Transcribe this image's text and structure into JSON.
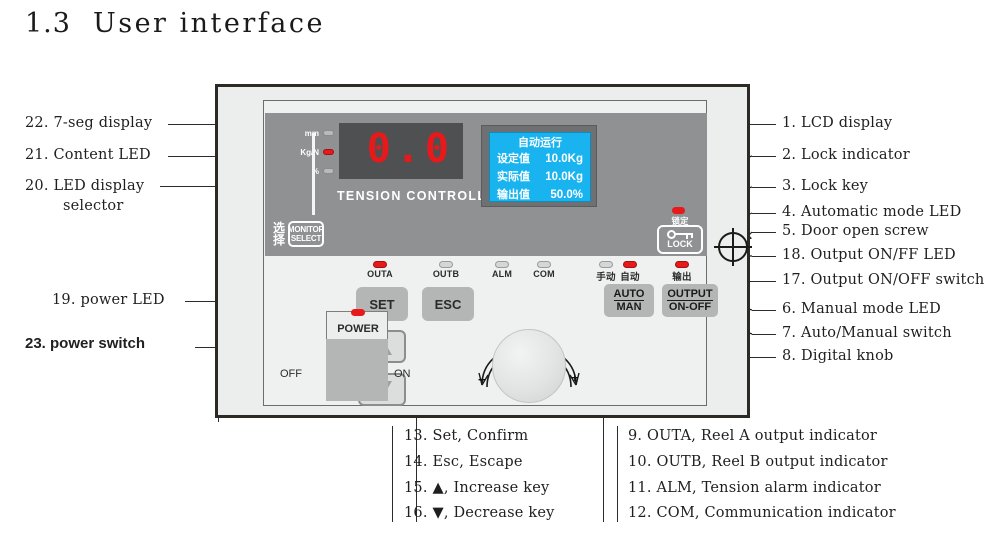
{
  "page": {
    "section_number": "1.3",
    "section_title": "User interface"
  },
  "callouts_left": [
    {
      "id": "22",
      "text": "22. 7-seg display"
    },
    {
      "id": "21",
      "text": "21. Content LED"
    },
    {
      "id": "20",
      "text": "20. LED display"
    },
    {
      "id": "20b",
      "text": "selector"
    },
    {
      "id": "19",
      "text": "19.  power LED"
    },
    {
      "id": "23",
      "text": "23. power switch"
    }
  ],
  "callouts_right": [
    {
      "id": "1",
      "text": "1.  LCD display"
    },
    {
      "id": "2",
      "text": "2.  Lock indicator"
    },
    {
      "id": "3",
      "text": "3.  Lock key"
    },
    {
      "id": "4",
      "text": "4.  Automatic mode LED"
    },
    {
      "id": "5",
      "text": "5.  Door open screw"
    },
    {
      "id": "18",
      "text": "18. Output ON/FF LED"
    },
    {
      "id": "17",
      "text": "17. Output ON/OFF switch"
    },
    {
      "id": "6",
      "text": "6.  Manual mode LED"
    },
    {
      "id": "7",
      "text": "7.  Auto/Manual switch"
    },
    {
      "id": "8",
      "text": "8.  Digital knob"
    }
  ],
  "callouts_bottom_left": [
    {
      "id": "13",
      "text": "13. Set, Confirm"
    },
    {
      "id": "14",
      "text": "14. Esc, Escape"
    },
    {
      "id": "15",
      "text": "15. ▲, Increase key"
    },
    {
      "id": "16",
      "text": "16. ▼, Decrease key"
    }
  ],
  "callouts_bottom_right": [
    {
      "id": "9",
      "text": "9.  OUTA, Reel A output indicator"
    },
    {
      "id": "10",
      "text": "10. OUTB, Reel B output indicator"
    },
    {
      "id": "11",
      "text": "11. ALM, Tension alarm indicator"
    },
    {
      "id": "12",
      "text": "12. COM, Communication indicator"
    }
  ],
  "device": {
    "brand": "TENSION CONTROLLER",
    "seven_segment": {
      "value": "0.0",
      "digits_left": "0",
      "decimal_point": ".",
      "digits_right": "0"
    },
    "unit_leds": [
      {
        "label": "mm",
        "state": "off"
      },
      {
        "label": "Kg/N",
        "state": "on"
      },
      {
        "label": "%",
        "state": "off"
      }
    ],
    "lcd": {
      "title": "自动运行",
      "rows": [
        {
          "key": "设定值",
          "value": "10.0Kg"
        },
        {
          "key": "实际值",
          "value": "10.0Kg"
        },
        {
          "key": "输出值",
          "value": "50.0%"
        }
      ]
    },
    "monitor_select": {
      "cn_line1": "选",
      "cn_line2": "择",
      "en_line1": "MONITOR",
      "en_line2": "SELECT"
    },
    "lock": {
      "cn": "锁定",
      "label": "LOCK",
      "led_state": "on"
    },
    "indicators": [
      {
        "label": "OUTA",
        "state": "on",
        "lang": "en"
      },
      {
        "label": "OUTB",
        "state": "off",
        "lang": "en"
      },
      {
        "label": "ALM",
        "state": "off",
        "lang": "en"
      },
      {
        "label": "COM",
        "state": "off",
        "lang": "en"
      },
      {
        "label": "手动",
        "state": "off",
        "lang": "cn"
      },
      {
        "label": "自动",
        "state": "on",
        "lang": "cn"
      },
      {
        "label": "输出",
        "state": "on",
        "lang": "cn"
      }
    ],
    "buttons": {
      "set": "SET",
      "esc": "ESC",
      "auto_man_top": "AUTO",
      "auto_man_bottom": "MAN",
      "output_top": "OUTPUT",
      "output_bottom": "ON-OFF"
    },
    "knob": {
      "minus": "−",
      "plus": "+"
    },
    "power": {
      "label": "POWER",
      "off": "OFF",
      "on": "ON",
      "led_state": "on"
    }
  },
  "colors": {
    "led_on": "#e8191b",
    "led_off": "#d5d7d7",
    "lcd_background": "#19b4f0",
    "lcd_text": "#ffffff",
    "seven_segment": "#e8191b",
    "panel_body": "#eceeee",
    "display_bank": "#8f9192",
    "button_gray": "#b4b6b6",
    "frame": "#2d2a26"
  }
}
